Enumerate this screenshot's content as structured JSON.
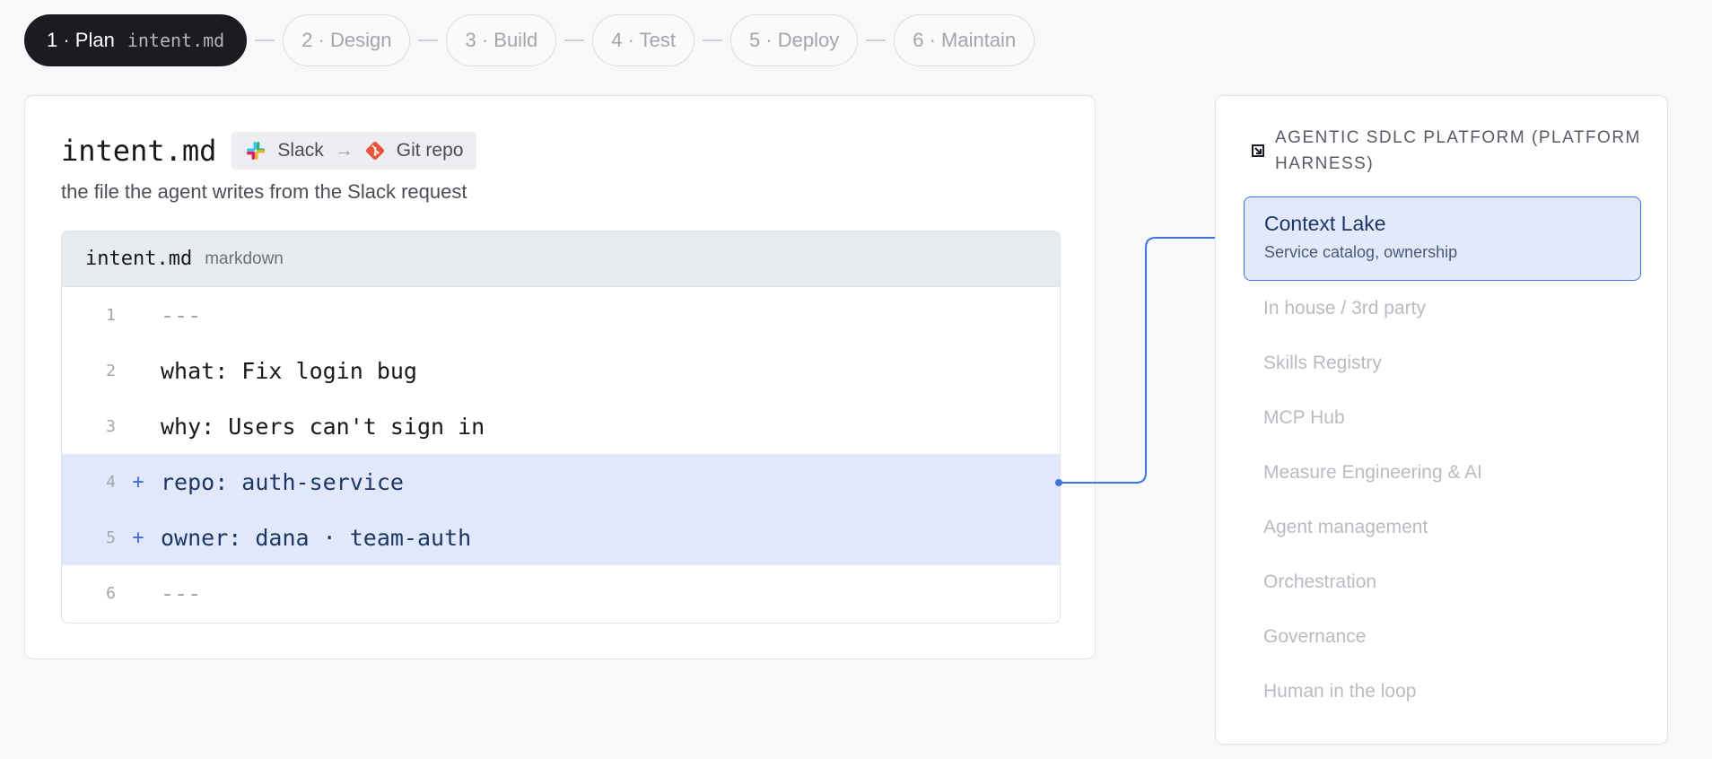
{
  "stepper": {
    "steps": [
      {
        "label": "1 · Plan",
        "file": "intent.md",
        "active": true
      },
      {
        "label": "2 · Design"
      },
      {
        "label": "3 · Build"
      },
      {
        "label": "4 · Test"
      },
      {
        "label": "5 · Deploy"
      },
      {
        "label": "6 · Maintain"
      }
    ]
  },
  "file_card": {
    "title": "intent.md",
    "source": {
      "from": "Slack",
      "to": "Git repo",
      "arrow": "→"
    },
    "description": "the file the agent writes from the Slack request"
  },
  "editor": {
    "filename": "intent.md",
    "language": "markdown",
    "lines": [
      {
        "number": "1",
        "marker": "",
        "text": "---"
      },
      {
        "number": "2",
        "marker": "",
        "text": "what: Fix login bug"
      },
      {
        "number": "3",
        "marker": "",
        "text": "why: Users can't sign in"
      },
      {
        "number": "4",
        "marker": "+",
        "text": "repo: auth-service"
      },
      {
        "number": "5",
        "marker": "+",
        "text": "owner: dana · team-auth"
      },
      {
        "number": "6",
        "marker": "",
        "text": "---"
      }
    ]
  },
  "platform": {
    "title": "AGENTIC SDLC PLATFORM (PLATFORM HARNESS)",
    "active_module": {
      "title": "Context Lake",
      "subtitle": "Service catalog, ownership"
    },
    "modules": [
      "In house / 3rd party",
      "Skills Registry",
      "MCP Hub",
      "Measure Engineering & AI",
      "Agent management",
      "Orchestration",
      "Governance",
      "Human in the loop"
    ]
  },
  "colors": {
    "accent": "#3d74e0",
    "active_step_bg": "#1b1b22",
    "added_line_bg": "#e1e8fb",
    "page_bg": "#f7f8fa"
  },
  "icons": {
    "source_from": "slack-logo-icon",
    "source_to": "git-logo-icon",
    "platform_header": "corner-arrow-icon"
  }
}
